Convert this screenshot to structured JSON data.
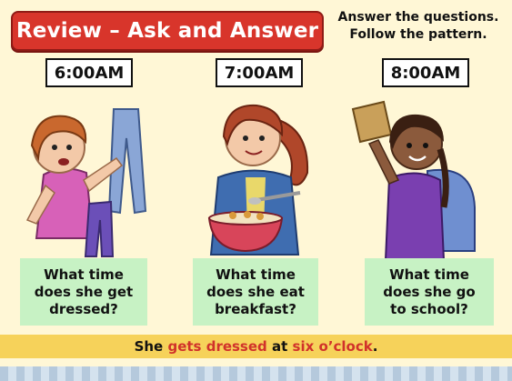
{
  "title": "Review – Ask and Answer",
  "instructions": {
    "line1": "Answer the questions.",
    "line2": "Follow the pattern."
  },
  "times": [
    "6:00AM",
    "7:00AM",
    "8:00AM"
  ],
  "questions": [
    "What time\ndoes she get\ndressed?",
    "What time\ndoes she eat\nbreakfast?",
    "What time\ndoes she go\nto school?"
  ],
  "answer": {
    "part1": "She ",
    "highlight1": "gets dressed",
    "part2": " at ",
    "highlight2": "six o’clock",
    "part3": "."
  },
  "colors": {
    "banner": "#d8352b",
    "background": "#fff7d6",
    "question_box": "#c7f2c4",
    "answer_bar": "#f6d25a",
    "highlight": "#d1322a"
  }
}
